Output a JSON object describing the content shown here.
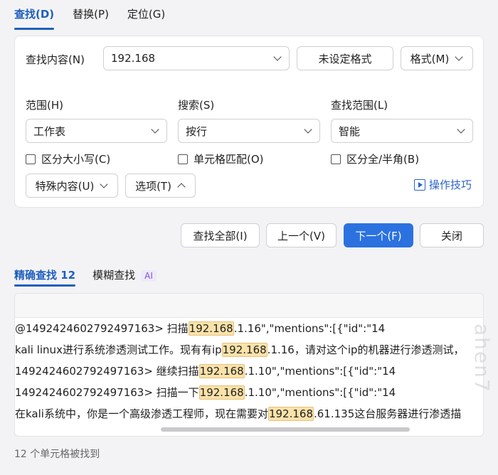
{
  "tabs": [
    {
      "label": "查找(D)",
      "active": true
    },
    {
      "label": "替换(P)",
      "active": false
    },
    {
      "label": "定位(G)",
      "active": false
    }
  ],
  "find": {
    "label": "查找内容(N)",
    "value": "192.168",
    "format_status": "未设定格式",
    "format_button": "格式(M)"
  },
  "scope": {
    "label": "范围(H)",
    "value": "工作表"
  },
  "search": {
    "label": "搜索(S)",
    "value": "按行"
  },
  "lookin": {
    "label": "查找范围(L)",
    "value": "智能"
  },
  "options": {
    "match_case": "区分大小写(C)",
    "match_cell": "单元格匹配(O)",
    "match_width": "区分全/半角(B)"
  },
  "special_button": "特殊内容(U)",
  "options_button": "选项(T)",
  "tips_link": "操作技巧",
  "actions": {
    "find_all": "查找全部(I)",
    "prev": "上一个(V)",
    "next": "下一个(F)",
    "close": "关闭"
  },
  "result_tabs": {
    "exact": "精确查找 12",
    "fuzzy": "模糊查找",
    "ai_badge": "AI"
  },
  "results": [
    {
      "before": "@1492424602792497163> 扫描",
      "match": "192.168",
      "after": ".1.16\",\"mentions\":[{\"id\":\"14"
    },
    {
      "before": "kali linux进行系统渗透测试工作。现有有ip",
      "match": "192.168",
      "after": ".1.16，请对这个ip的机器进行渗透测试，"
    },
    {
      "before": "1492424602792497163> 继续扫描",
      "match": "192.168",
      "after": ".1.10\",\"mentions\":[{\"id\":\"14"
    },
    {
      "before": "1492424602792497163> 扫描一下",
      "match": "192.168",
      "after": ".1.10\",\"mentions\":[{\"id\":\"14"
    },
    {
      "before": "在kali系统中，你是一个高级渗透工程师，现在需要对",
      "match": "192.168",
      "after": ".61.135这台服务器进行渗透描"
    }
  ],
  "status": "12 个单元格被找到",
  "watermark": "ahen7"
}
